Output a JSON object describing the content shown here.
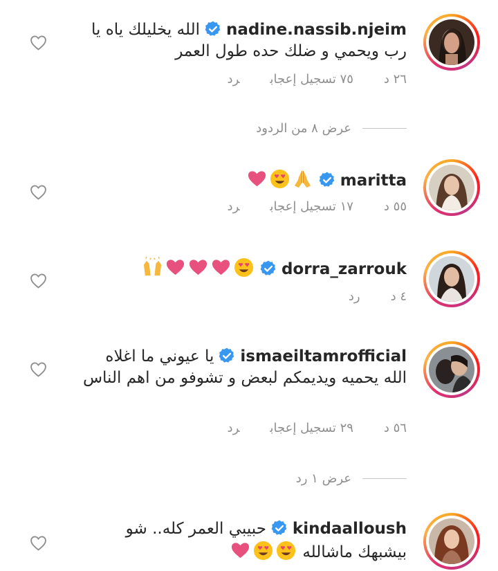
{
  "comments": [
    {
      "username": "nadine.nassib.njeim",
      "text": "الله يخليلك ياه يا رب ويحمي و ضلك حده طول العمر",
      "emojis": [],
      "time": "٢٦ د",
      "likes": "٧٥ تسجيل إعجاب",
      "reply": "رد"
    },
    {
      "username": "maritta",
      "text": "",
      "emojis": [
        "folded-hands-emoji",
        "heart-eyes-emoji",
        "pink-heart-emoji"
      ],
      "time": "٥٥ د",
      "likes": "١٧ تسجيل إعجاب",
      "reply": "رد"
    },
    {
      "username": "dorra_zarrouk",
      "text": "",
      "emojis": [
        "heart-eyes-emoji",
        "pink-heart-emoji",
        "pink-heart-emoji",
        "pink-heart-emoji",
        "raised-hands-emoji"
      ],
      "time": "٤ د",
      "reply": "رد"
    },
    {
      "username": "ismaeiltamrofficial",
      "text": "يا عيوني ما اغلاه الله يحميه ويديمكم لبعض و تشوفو من اهم الناس",
      "emojis": [],
      "time": "٥٦ د",
      "likes": "٢٩ تسجيل إعجاب",
      "reply": "رد"
    },
    {
      "username": "kindaalloush",
      "text": "حبيبي العمر كله.. شو بيشبهك ماشالله",
      "emojis": [
        "heart-eyes-emoji",
        "heart-eyes-emoji",
        "pink-heart-emoji"
      ]
    }
  ],
  "view_replies": [
    "عرض ٨ من الردود",
    "عرض ١ رد"
  ],
  "colors": {
    "verified": "#3897f0",
    "meta": "#8e8e8e",
    "heart_emoji": "#e8507e"
  }
}
